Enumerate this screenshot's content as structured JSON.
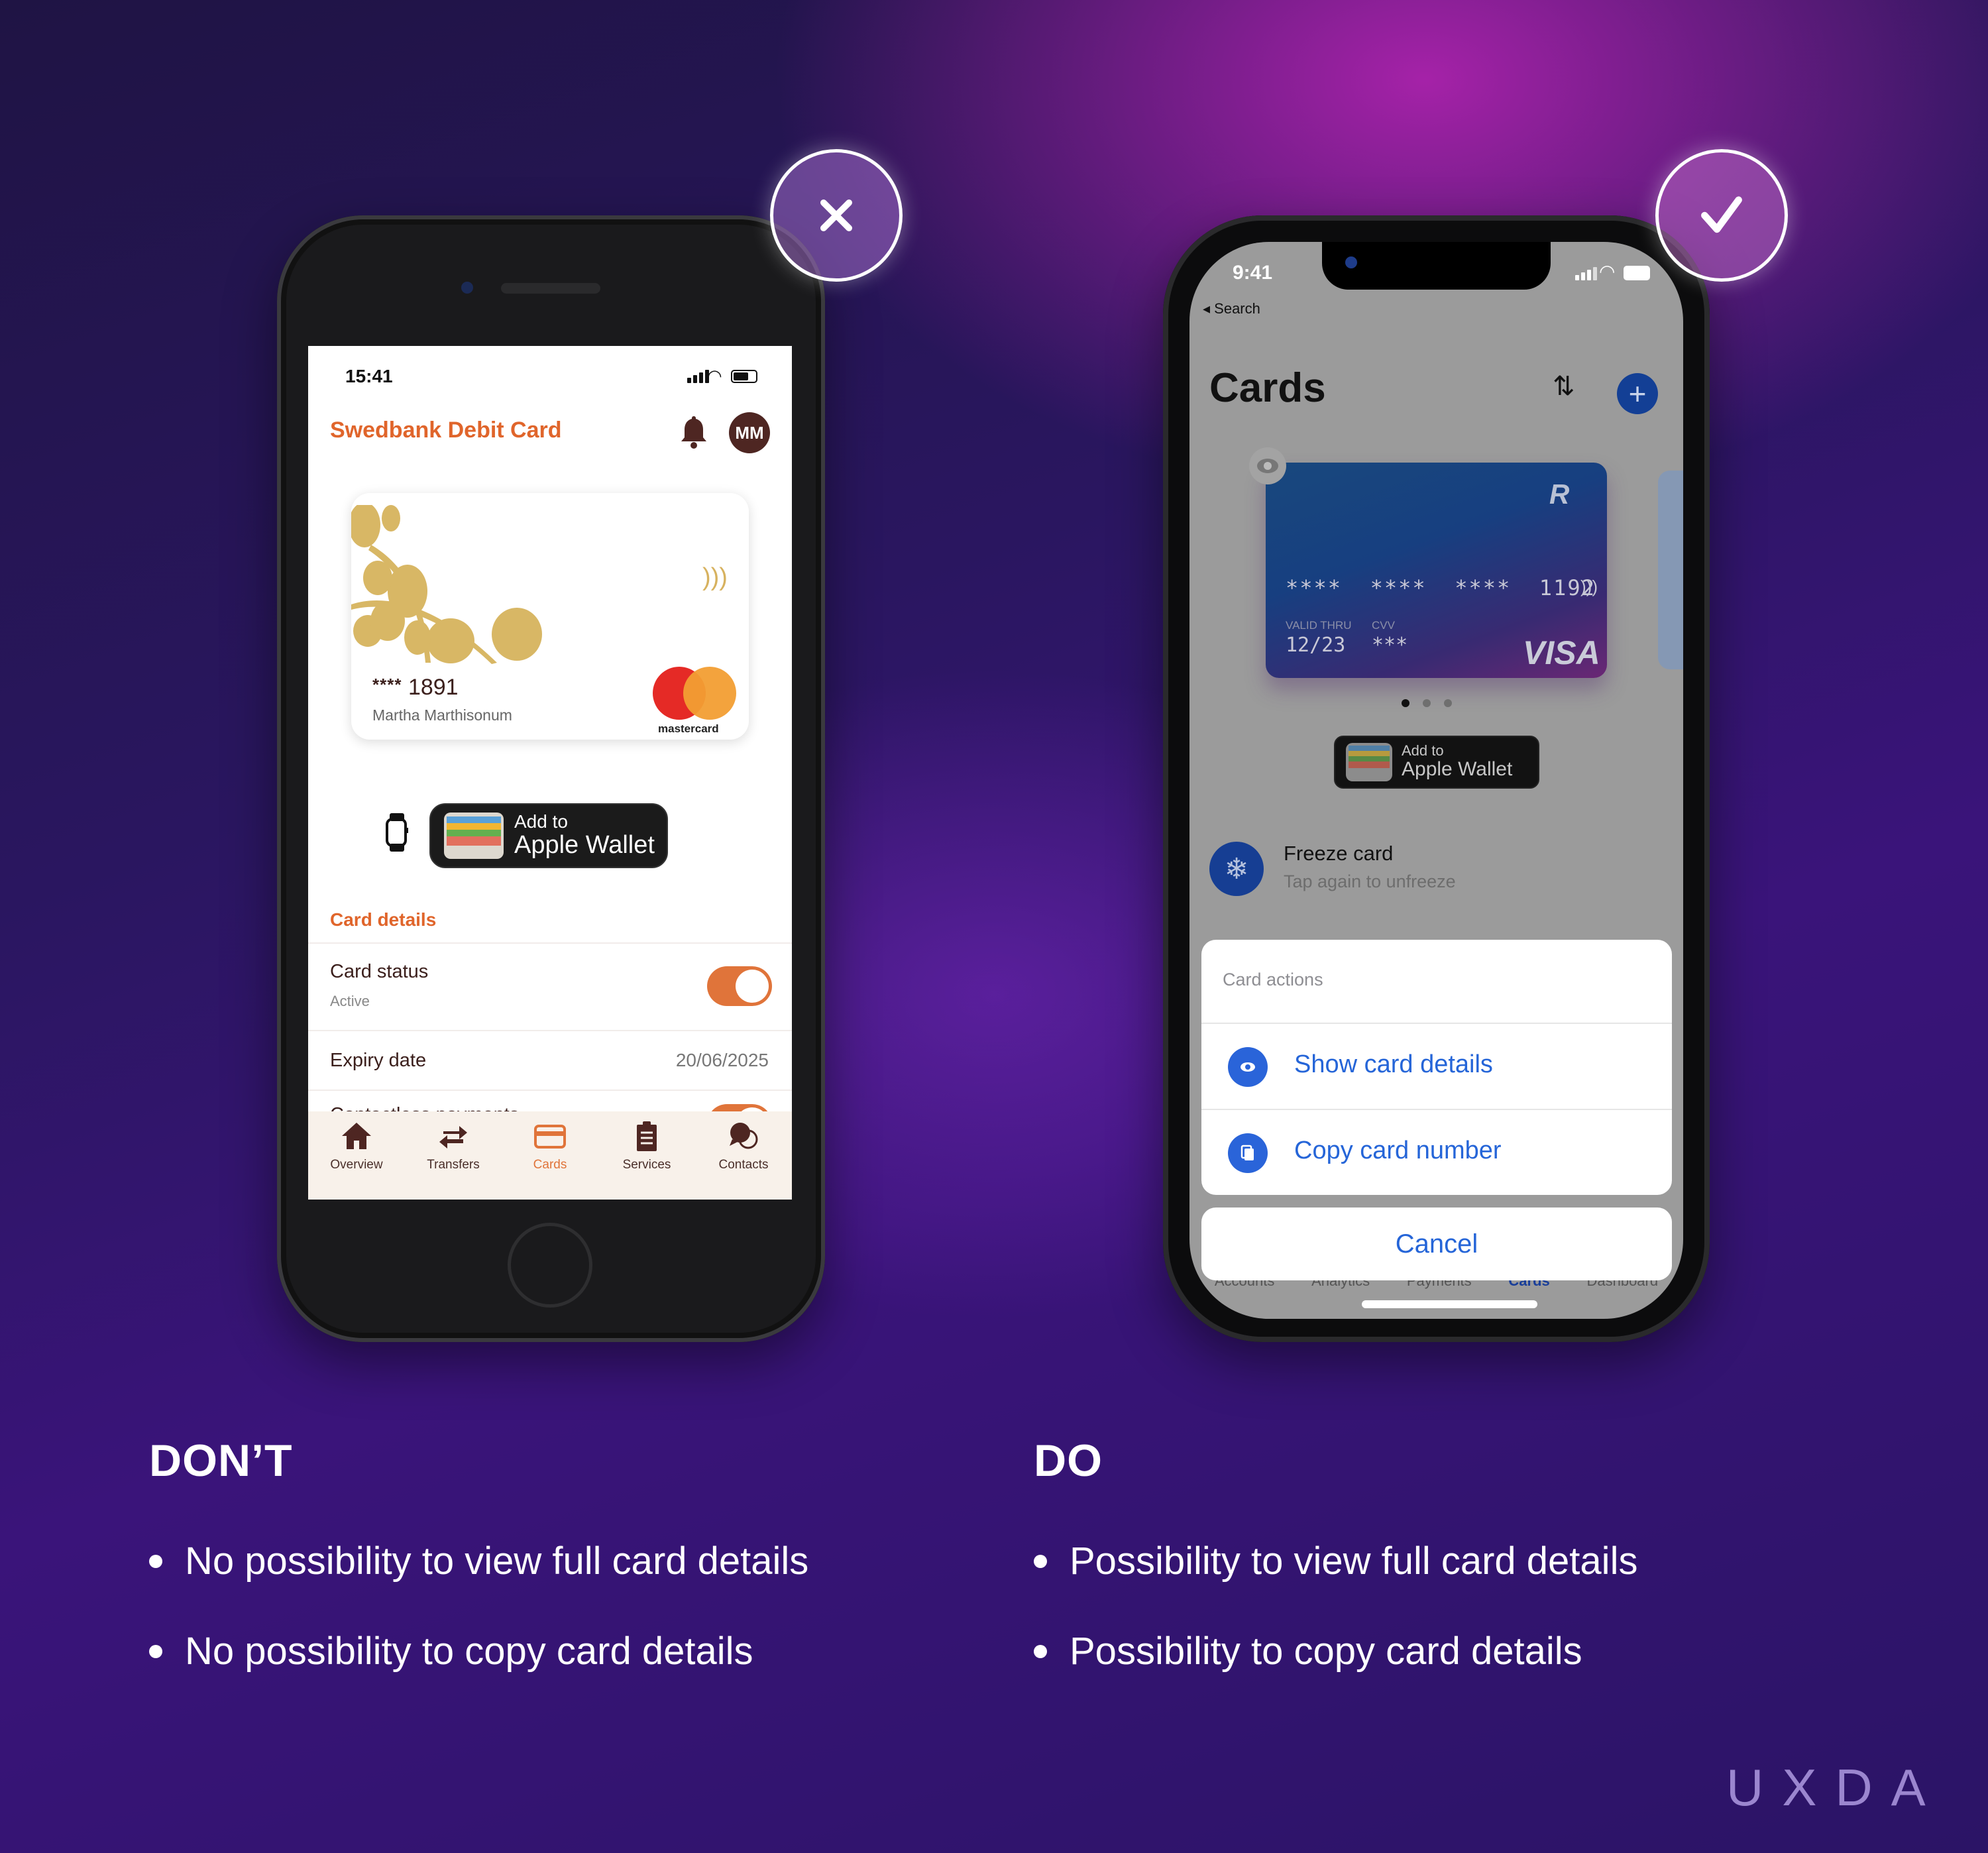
{
  "badges": {
    "dont_icon": "close-x-icon",
    "do_icon": "checkmark-icon"
  },
  "left_phone": {
    "status_time": "15:41",
    "header_title": "Swedbank Debit Card",
    "avatar_initials": "MM",
    "card": {
      "masked_prefix": "****",
      "last4": "1891",
      "holder": "Martha Marthisonum",
      "network": "mastercard"
    },
    "wallet_button": {
      "line1": "Add to",
      "line2": "Apple Wallet"
    },
    "section_title": "Card details",
    "rows": [
      {
        "label": "Card status",
        "sub": "Active",
        "toggle": true
      },
      {
        "label": "Expiry date",
        "value": "20/06/2025"
      },
      {
        "label": "Contactless payments",
        "toggle": true
      }
    ],
    "tabs": [
      {
        "label": "Overview",
        "icon": "home-icon"
      },
      {
        "label": "Transfers",
        "icon": "transfer-arrows-icon"
      },
      {
        "label": "Cards",
        "icon": "card-icon",
        "active": true
      },
      {
        "label": "Services",
        "icon": "clipboard-icon"
      },
      {
        "label": "Contacts",
        "icon": "chat-bubbles-icon"
      }
    ],
    "colors": {
      "accent": "#e0652b",
      "dark": "#4e2622",
      "tabbar_bg": "#f8f1ea"
    }
  },
  "right_phone": {
    "status_time": "9:41",
    "back_label": "◂ Search",
    "page_title": "Cards",
    "card": {
      "pan": "****  ****  ****  1192",
      "valid_label": "VALID THRU",
      "valid": "12/23",
      "cvv_label": "CVV",
      "cvv": "***",
      "brand": "VISA",
      "logo": "R"
    },
    "pager": {
      "count": 3,
      "active": 1
    },
    "wallet_button": {
      "line1": "Add to",
      "line2": "Apple Wallet"
    },
    "freeze": {
      "title": "Freeze card",
      "subtitle": "Tap again to unfreeze"
    },
    "sheet": {
      "header": "Card actions",
      "items": [
        {
          "label": "Show card details",
          "icon": "eye-icon"
        },
        {
          "label": "Copy card number",
          "icon": "copy-icon"
        }
      ],
      "cancel": "Cancel"
    },
    "tabs": [
      "Accounts",
      "Analytics",
      "Payments",
      "Cards",
      "Dashboard"
    ],
    "active_tab": "Cards",
    "colors": {
      "accent": "#2565d8",
      "navy": "#163e93"
    }
  },
  "dont": {
    "heading": "DON’T",
    "bullets": [
      "No possibility to view full card details",
      "No possibility to copy card details"
    ]
  },
  "do": {
    "heading": "DO",
    "bullets": [
      "Possibility to view full card details",
      "Possibility to copy card details"
    ]
  },
  "brand": "UXDA"
}
